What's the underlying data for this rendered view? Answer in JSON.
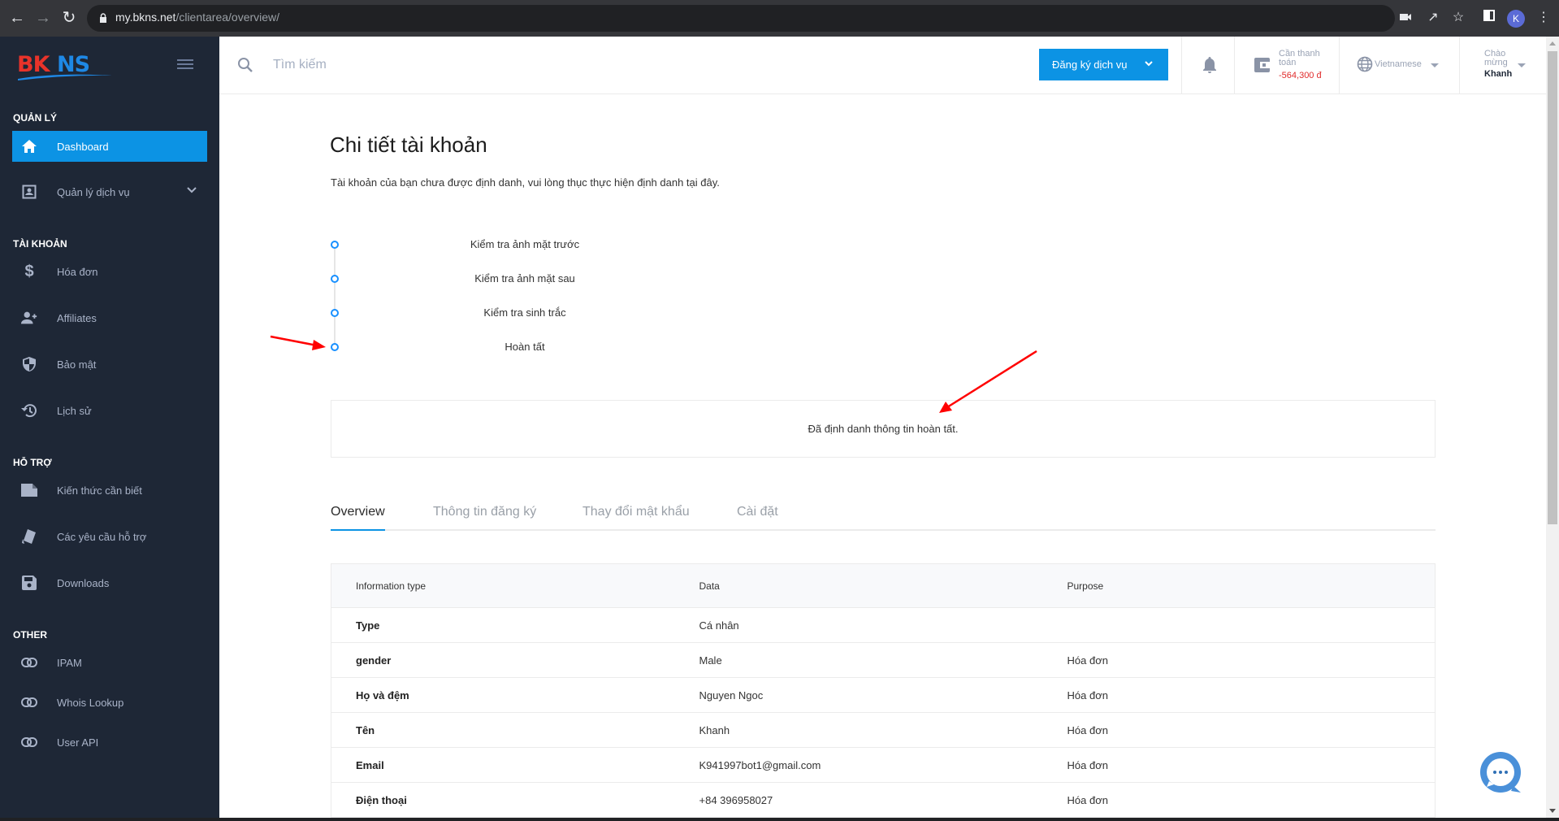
{
  "browser": {
    "url_host": "my.bkns.net",
    "url_path": "/clientarea/overview/",
    "profile_initial": "K"
  },
  "sidebar": {
    "logo_text": "BKNS",
    "sections": [
      {
        "title": "QUẢN LÝ"
      },
      {
        "title": "TÀI KHOẢN"
      },
      {
        "title": "HỖ TRỢ"
      },
      {
        "title": "OTHER"
      }
    ],
    "items": [
      {
        "label": "Dashboard",
        "icon": "home-icon",
        "active": true
      },
      {
        "label": "Quản lý dịch vụ",
        "icon": "account-box-icon"
      },
      {
        "label": "Hóa đơn",
        "icon": "dollar-icon"
      },
      {
        "label": "Affiliates",
        "icon": "add-user-icon"
      },
      {
        "label": "Bảo mật",
        "icon": "shield-icon"
      },
      {
        "label": "Lịch sử",
        "icon": "history-icon"
      },
      {
        "label": "Kiến thức cần biết",
        "icon": "document-icon"
      },
      {
        "label": "Các yêu cầu hỗ trợ",
        "icon": "ticket-icon"
      },
      {
        "label": "Downloads",
        "icon": "save-icon"
      },
      {
        "label": "IPAM",
        "icon": "link-icon"
      },
      {
        "label": "Whois Lookup",
        "icon": "link-icon"
      },
      {
        "label": "User API",
        "icon": "link-icon"
      }
    ]
  },
  "header": {
    "search_placeholder": "Tìm kiếm",
    "register_button": "Đăng ký dịch vụ",
    "payment_label": "Cần thanh toán",
    "payment_amount": "-564,300 đ",
    "language": "Vietnamese",
    "greeting": "Chào mừng",
    "user_name": "Khanh"
  },
  "main": {
    "title": "Chi tiết tài khoản",
    "subtitle": "Tài khoản của bạn chưa được định danh, vui lòng thục thực hiện định danh tại đây.",
    "steps": [
      {
        "label": "Kiểm tra ảnh mặt trước"
      },
      {
        "label": "Kiểm tra ảnh mặt sau"
      },
      {
        "label": "Kiểm tra sinh trắc"
      },
      {
        "label": "Hoàn tất"
      }
    ],
    "notice": "Đã định danh thông tin hoàn tất.",
    "tabs": [
      {
        "label": "Overview",
        "active": true
      },
      {
        "label": "Thông tin đăng ký"
      },
      {
        "label": "Thay đổi mật khẩu"
      },
      {
        "label": "Cài đặt"
      }
    ],
    "table": {
      "headers": [
        "Information type",
        "Data",
        "Purpose"
      ],
      "rows": [
        [
          "Type",
          "Cá nhân",
          ""
        ],
        [
          "gender",
          "Male",
          "Hóa đơn"
        ],
        [
          "Họ và đệm",
          "Nguyen Ngoc",
          "Hóa đơn"
        ],
        [
          "Tên",
          "Khanh",
          "Hóa đơn"
        ],
        [
          "Email",
          "K941997bot1@gmail.com",
          "Hóa đơn"
        ],
        [
          "Điện thoại",
          "+84 396958027",
          "Hóa đơn"
        ]
      ]
    }
  },
  "colors": {
    "sidebar_bg": "#1e2736",
    "accent": "#0c93e4",
    "payment_negative": "#e02b2b",
    "annotation_arrow": "#ff0000"
  }
}
